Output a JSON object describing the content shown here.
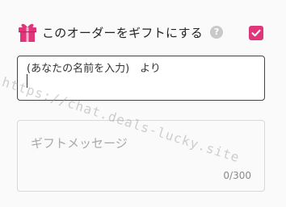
{
  "gift_option": {
    "label": "このオーダーをギフトにする",
    "checked": true,
    "accent_color": "#e0357b",
    "icons": [
      "gift-icon",
      "help-icon",
      "checkmark-icon"
    ],
    "help_glyph": "?"
  },
  "from_field": {
    "value": "(あなたの名前を入力)　より"
  },
  "message_field": {
    "placeholder": "ギフトメッセージ",
    "counter": "0/300"
  },
  "watermark": {
    "text": "https://chat.deals-lucky.site"
  }
}
